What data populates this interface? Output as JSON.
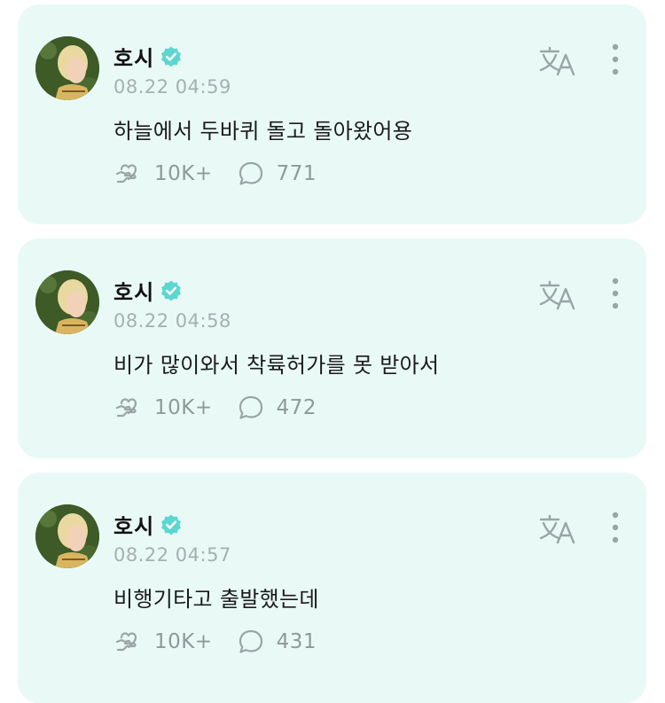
{
  "colors": {
    "card_background": "#e9faf6",
    "verified_badge": "#5cd6d1",
    "icon_gray": "#9aa5a5",
    "timestamp_gray": "#a5b0b0"
  },
  "posts": [
    {
      "author": "호시",
      "verified": true,
      "timestamp": "08.22 04:59",
      "text": "하늘에서 두바퀴 돌고 돌아왔어용",
      "likes": "10K+",
      "comments": "771",
      "icons": {
        "translate": "translate-icon",
        "more": "more-vertical-icon",
        "like": "heart-hand-icon",
        "comment": "comment-bubble-icon"
      }
    },
    {
      "author": "호시",
      "verified": true,
      "timestamp": "08.22 04:58",
      "text": "비가 많이와서 착륙허가를 못 받아서",
      "likes": "10K+",
      "comments": "472",
      "icons": {
        "translate": "translate-icon",
        "more": "more-vertical-icon",
        "like": "heart-hand-icon",
        "comment": "comment-bubble-icon"
      }
    },
    {
      "author": "호시",
      "verified": true,
      "timestamp": "08.22 04:57",
      "text": "비행기타고 출발했는데",
      "likes": "10K+",
      "comments": "431",
      "icons": {
        "translate": "translate-icon",
        "more": "more-vertical-icon",
        "like": "heart-hand-icon",
        "comment": "comment-bubble-icon"
      }
    }
  ]
}
